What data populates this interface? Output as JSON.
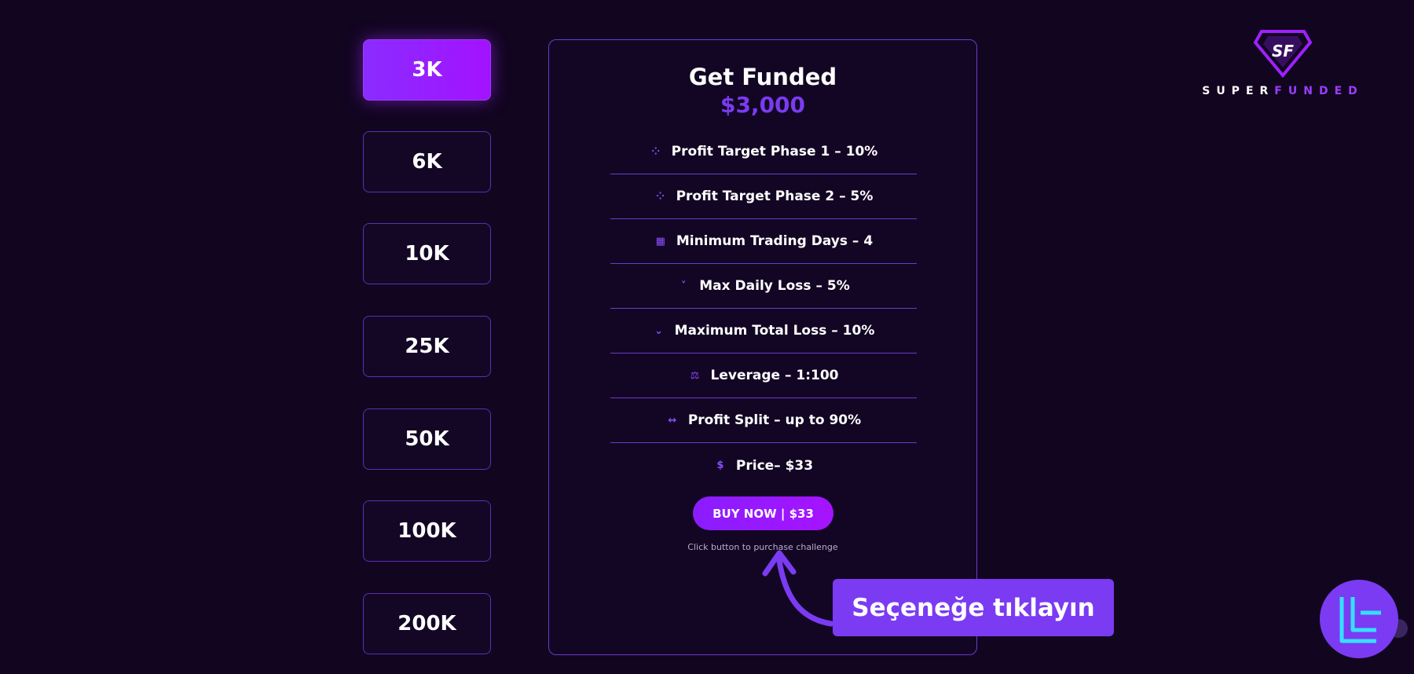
{
  "tiers": [
    "3K",
    "6K",
    "10K",
    "25K",
    "50K",
    "100K",
    "200K"
  ],
  "selected_tier": "3K",
  "card": {
    "title": "Get Funded",
    "amount": "$3,000",
    "features": [
      {
        "icon": "compress-icon",
        "glyph": "⁘",
        "text": "Profit Target Phase 1 – 10%"
      },
      {
        "icon": "compress-icon",
        "glyph": "⁘",
        "text": "Profit Target Phase 2 – 5%"
      },
      {
        "icon": "calendar-icon",
        "glyph": "▦",
        "text": "Minimum Trading Days – 4"
      },
      {
        "icon": "chevron-down-icon",
        "glyph": "˅",
        "text": "Max Daily Loss – 5%"
      },
      {
        "icon": "double-chevron-down-icon",
        "glyph": "⌄",
        "text": "Maximum Total Loss – 10%"
      },
      {
        "icon": "scale-icon",
        "glyph": "⚖",
        "text": "Leverage – 1:100"
      },
      {
        "icon": "arrows-horizontal-icon",
        "glyph": "↔",
        "text": "Profit Split – up to 90%"
      },
      {
        "icon": "dollar-icon",
        "glyph": "$",
        "text": "Price– $33"
      }
    ],
    "buy_label": "BUY NOW | $33",
    "buy_note": "Click button to purchase challenge"
  },
  "logo": {
    "part1": "SUPER",
    "part2": "FUNDED",
    "mark": "SF"
  },
  "callout": "Seçeneğe tıklayın",
  "colors": {
    "accent": "#8a2cff",
    "background": "#120520",
    "callout": "#7b3bf2",
    "badge": "#7b3bf2",
    "badge_glyph": "#35e0ff"
  }
}
